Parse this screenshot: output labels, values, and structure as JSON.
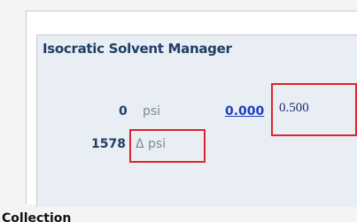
{
  "manager": {
    "title": "Isocratic Solvent Manager",
    "pressure_value": "0",
    "pressure_unit": "psi",
    "flow_link": "0.000",
    "flow_setpoint": "0.500",
    "delta_value": "1578",
    "delta_unit": "Δ psi"
  },
  "footer": {
    "partial_text": "Collection"
  },
  "colors": {
    "title": "#1f3e66",
    "panel_bg": "#e9eef5",
    "highlight": "#e0242c",
    "link": "#1f3fbf"
  }
}
